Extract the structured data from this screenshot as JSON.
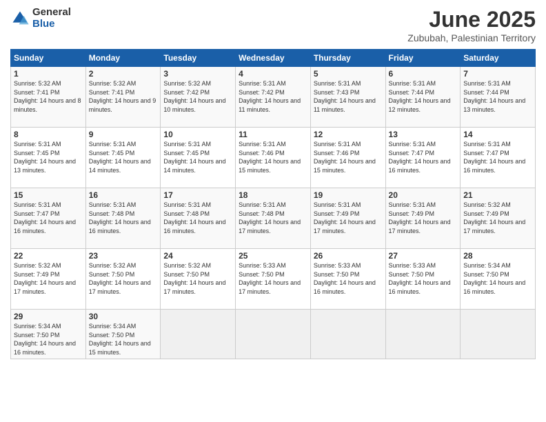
{
  "logo": {
    "general": "General",
    "blue": "Blue"
  },
  "header": {
    "month": "June 2025",
    "location": "Zububah, Palestinian Territory"
  },
  "weekdays": [
    "Sunday",
    "Monday",
    "Tuesday",
    "Wednesday",
    "Thursday",
    "Friday",
    "Saturday"
  ],
  "weeks": [
    [
      {
        "day": "1",
        "sunrise": "5:32 AM",
        "sunset": "7:41 PM",
        "daylight": "14 hours and 8 minutes."
      },
      {
        "day": "2",
        "sunrise": "5:32 AM",
        "sunset": "7:41 PM",
        "daylight": "14 hours and 9 minutes."
      },
      {
        "day": "3",
        "sunrise": "5:32 AM",
        "sunset": "7:42 PM",
        "daylight": "14 hours and 10 minutes."
      },
      {
        "day": "4",
        "sunrise": "5:31 AM",
        "sunset": "7:42 PM",
        "daylight": "14 hours and 11 minutes."
      },
      {
        "day": "5",
        "sunrise": "5:31 AM",
        "sunset": "7:43 PM",
        "daylight": "14 hours and 11 minutes."
      },
      {
        "day": "6",
        "sunrise": "5:31 AM",
        "sunset": "7:44 PM",
        "daylight": "14 hours and 12 minutes."
      },
      {
        "day": "7",
        "sunrise": "5:31 AM",
        "sunset": "7:44 PM",
        "daylight": "14 hours and 13 minutes."
      }
    ],
    [
      {
        "day": "8",
        "sunrise": "5:31 AM",
        "sunset": "7:45 PM",
        "daylight": "14 hours and 13 minutes."
      },
      {
        "day": "9",
        "sunrise": "5:31 AM",
        "sunset": "7:45 PM",
        "daylight": "14 hours and 14 minutes."
      },
      {
        "day": "10",
        "sunrise": "5:31 AM",
        "sunset": "7:45 PM",
        "daylight": "14 hours and 14 minutes."
      },
      {
        "day": "11",
        "sunrise": "5:31 AM",
        "sunset": "7:46 PM",
        "daylight": "14 hours and 15 minutes."
      },
      {
        "day": "12",
        "sunrise": "5:31 AM",
        "sunset": "7:46 PM",
        "daylight": "14 hours and 15 minutes."
      },
      {
        "day": "13",
        "sunrise": "5:31 AM",
        "sunset": "7:47 PM",
        "daylight": "14 hours and 16 minutes."
      },
      {
        "day": "14",
        "sunrise": "5:31 AM",
        "sunset": "7:47 PM",
        "daylight": "14 hours and 16 minutes."
      }
    ],
    [
      {
        "day": "15",
        "sunrise": "5:31 AM",
        "sunset": "7:47 PM",
        "daylight": "14 hours and 16 minutes."
      },
      {
        "day": "16",
        "sunrise": "5:31 AM",
        "sunset": "7:48 PM",
        "daylight": "14 hours and 16 minutes."
      },
      {
        "day": "17",
        "sunrise": "5:31 AM",
        "sunset": "7:48 PM",
        "daylight": "14 hours and 16 minutes."
      },
      {
        "day": "18",
        "sunrise": "5:31 AM",
        "sunset": "7:48 PM",
        "daylight": "14 hours and 17 minutes."
      },
      {
        "day": "19",
        "sunrise": "5:31 AM",
        "sunset": "7:49 PM",
        "daylight": "14 hours and 17 minutes."
      },
      {
        "day": "20",
        "sunrise": "5:31 AM",
        "sunset": "7:49 PM",
        "daylight": "14 hours and 17 minutes."
      },
      {
        "day": "21",
        "sunrise": "5:32 AM",
        "sunset": "7:49 PM",
        "daylight": "14 hours and 17 minutes."
      }
    ],
    [
      {
        "day": "22",
        "sunrise": "5:32 AM",
        "sunset": "7:49 PM",
        "daylight": "14 hours and 17 minutes."
      },
      {
        "day": "23",
        "sunrise": "5:32 AM",
        "sunset": "7:50 PM",
        "daylight": "14 hours and 17 minutes."
      },
      {
        "day": "24",
        "sunrise": "5:32 AM",
        "sunset": "7:50 PM",
        "daylight": "14 hours and 17 minutes."
      },
      {
        "day": "25",
        "sunrise": "5:33 AM",
        "sunset": "7:50 PM",
        "daylight": "14 hours and 17 minutes."
      },
      {
        "day": "26",
        "sunrise": "5:33 AM",
        "sunset": "7:50 PM",
        "daylight": "14 hours and 16 minutes."
      },
      {
        "day": "27",
        "sunrise": "5:33 AM",
        "sunset": "7:50 PM",
        "daylight": "14 hours and 16 minutes."
      },
      {
        "day": "28",
        "sunrise": "5:34 AM",
        "sunset": "7:50 PM",
        "daylight": "14 hours and 16 minutes."
      }
    ],
    [
      {
        "day": "29",
        "sunrise": "5:34 AM",
        "sunset": "7:50 PM",
        "daylight": "14 hours and 16 minutes."
      },
      {
        "day": "30",
        "sunrise": "5:34 AM",
        "sunset": "7:50 PM",
        "daylight": "14 hours and 15 minutes."
      },
      null,
      null,
      null,
      null,
      null
    ]
  ]
}
